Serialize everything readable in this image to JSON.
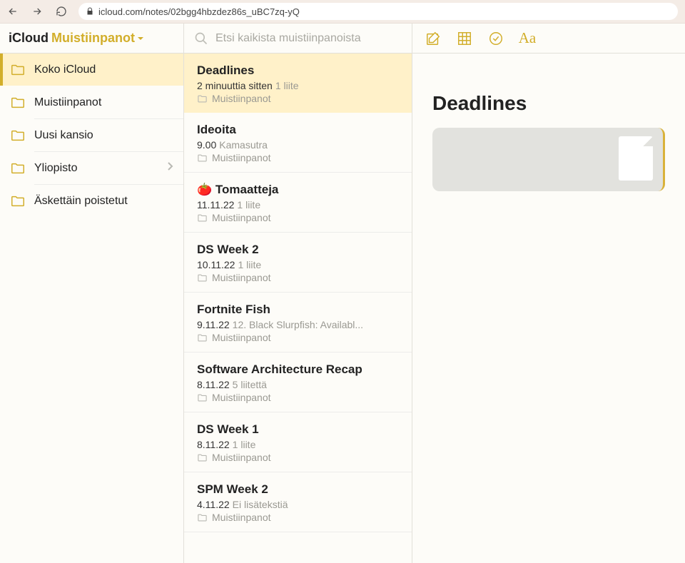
{
  "browser": {
    "url": "icloud.com/notes/02bgg4hbzdez86s_uBC7zq-yQ"
  },
  "brand": {
    "icloud": "iCloud",
    "app": "Muistiinpanot"
  },
  "search": {
    "placeholder": "Etsi kaikista muistiinpanoista"
  },
  "folders": [
    {
      "label": "Koko iCloud",
      "active": true
    },
    {
      "label": "Muistiinpanot",
      "active": false
    },
    {
      "label": "Uusi kansio",
      "active": false
    },
    {
      "label": "Yliopisto",
      "active": false,
      "chevron": true
    },
    {
      "label": "Äskettäin poistetut",
      "active": false
    }
  ],
  "notes": [
    {
      "title": "Deadlines",
      "date": "2 minuuttia sitten",
      "preview": "1 liite",
      "folder": "Muistiinpanot",
      "active": true
    },
    {
      "title": "Ideoita",
      "date": "9.00",
      "preview": "Kamasutra",
      "folder": "Muistiinpanot"
    },
    {
      "title": "🍅 Tomaatteja",
      "date": "11.11.22",
      "preview": "1 liite",
      "folder": "Muistiinpanot"
    },
    {
      "title": "DS Week 2",
      "date": "10.11.22",
      "preview": "1 liite",
      "folder": "Muistiinpanot"
    },
    {
      "title": "Fortnite Fish",
      "date": "9.11.22",
      "preview": "12. Black Slurpfish: Availabl...",
      "folder": "Muistiinpanot"
    },
    {
      "title": "Software Architecture Recap",
      "date": "8.11.22",
      "preview": "5 liitettä",
      "folder": "Muistiinpanot"
    },
    {
      "title": "DS Week 1",
      "date": "8.11.22",
      "preview": "1 liite",
      "folder": "Muistiinpanot"
    },
    {
      "title": "SPM Week 2",
      "date": "4.11.22",
      "preview": "Ei lisätekstiä",
      "folder": "Muistiinpanot"
    }
  ],
  "editor": {
    "title": "Deadlines"
  }
}
